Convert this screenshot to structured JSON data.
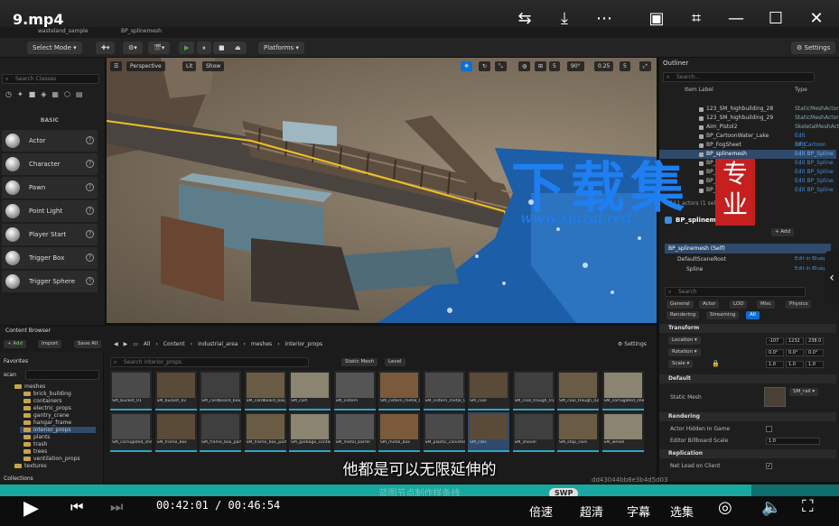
{
  "player": {
    "title": "9.mp4",
    "current_time": "00:42:01",
    "total_time": "00:46:54",
    "progress": 0.8958,
    "speed_label": "倍速",
    "quality_label": "超清",
    "subtitle_label": "字幕",
    "episodes_label": "选集",
    "swp_badge": "SWP",
    "subtitle_text": "他都是可以无限延伸的",
    "chapter_caption": "蓝图节点制作样条线",
    "info_text": "dd43044bb8e3b4d5d03"
  },
  "ue": {
    "tabs": [
      "wasteland_sample",
      "BP_splinemesh"
    ],
    "toolbar": {
      "select_mode": "Select Mode",
      "platforms": "Platforms",
      "settings": "Settings"
    },
    "place_actors": {
      "search_placeholder": "Search Classes",
      "category": "BASIC",
      "items": [
        "Actor",
        "Character",
        "Pawn",
        "Point Light",
        "Player Start",
        "Trigger Box",
        "Trigger Sphere"
      ]
    },
    "viewport": {
      "perspective": "Perspective",
      "lit": "Lit",
      "show": "Show",
      "grid": "5",
      "angle": "90°",
      "scale": "0.25",
      "cam": "5"
    },
    "outliner": {
      "title": "Outliner",
      "search_placeholder": "Search...",
      "col_label": "Item Label",
      "col_type": "Type",
      "rows": [
        {
          "name": "123_SM_highbuilding_28",
          "type": "StaticMeshActor"
        },
        {
          "name": "123_SM_highbuilding_29",
          "type": "StaticMeshActor"
        },
        {
          "name": "Aim_Pistol2",
          "type": "SkeletalMeshActor"
        },
        {
          "name": "BP_CartoonWater_Lake",
          "type": "Edit BP_Cartoon"
        },
        {
          "name": "BP_FogSheet",
          "type": "Edit BP_FogShe"
        },
        {
          "name": "BP_splinemesh",
          "type": "Edit BP_Spline"
        },
        {
          "name": "BP_Splinemesh_1",
          "type": "Edit BP_Spline"
        },
        {
          "name": "BP_Splinemesh_2",
          "type": "Edit BP_Spline"
        },
        {
          "name": "BP_Splinemesh_3",
          "type": "Edit BP_Spline"
        },
        {
          "name": "BP_Splinemesh_4",
          "type": "Edit BP_Spline"
        }
      ],
      "status": "2,111 actors (1 selected)"
    },
    "details": {
      "title": "BP_splinemesh",
      "add_label": "+ Add",
      "self_label": "BP_splinemesh (Self)",
      "components": [
        {
          "name": "DefaultSceneRoot",
          "link": "Edit in Blueprint"
        },
        {
          "name": "Spline",
          "link": "Edit in Blueprint"
        }
      ],
      "search_placeholder": "Search",
      "filter_tabs": [
        "General",
        "Actor",
        "LOD",
        "Misc",
        "Physics",
        "Rendering",
        "Streaming",
        "All"
      ],
      "transform": {
        "section": "Transform",
        "location_label": "Location",
        "rotation_label": "Rotation",
        "scale_label": "Scale",
        "location": [
          "-107",
          "1232",
          "238.0"
        ],
        "rotation": [
          "0.0°",
          "0.0°",
          "0.0°"
        ],
        "scale": [
          "1.0",
          "1.0",
          "1.0"
        ]
      },
      "default_section": "Default",
      "static_mesh_label": "Static Mesh",
      "static_mesh_value": "SM_rail",
      "rendering_section": "Rendering",
      "actor_hidden_label": "Actor Hidden In Game",
      "billboard_label": "Editor Billboard Scale",
      "billboard_value": "1.0",
      "replication_section": "Replication",
      "net_load_label": "Net Load on Client"
    },
    "content_browser": {
      "title": "Content Browser",
      "add": "+ Add",
      "import": "Import",
      "save_all": "Save All",
      "path": [
        "All",
        "Content",
        "industrial_area",
        "meshes",
        "interior_props"
      ],
      "settings": "Settings",
      "search_placeholder": "Search interior_props",
      "filter_static": "Static Mesh",
      "filter_level": "Level",
      "favorites": "Favorites",
      "root": "scan",
      "tree": [
        "meshes",
        "brick_building",
        "containers",
        "electric_props",
        "gantry_crane",
        "hangar_frame",
        "interior_props",
        "plants",
        "trash",
        "trees",
        "ventilation_props",
        "textures"
      ],
      "collections": "Collections",
      "row1": [
        "SM_bucket_01",
        "SM_bucket_02",
        "SM_cardboard_box_01",
        "SM_cardboard_box_03",
        "SM_cart",
        "SM_cistern",
        "SM_cistern_metal_01",
        "SM_cistern_metal_02",
        "SM_coal",
        "SM_coal_trough_01",
        "SM_coal_trough_02",
        "SM_corrugated_sheet_01"
      ],
      "row2": [
        "SM_corrugated_sheet_02",
        "SM_frame_box",
        "SM_frame_box_part_01",
        "SM_frame_box_part_02",
        "SM_garbage_container",
        "SM_metal_barrel",
        "SM_metal_box",
        "SM_plastic_canister",
        "SM_rails",
        "SM_shovel",
        "SM_stop_rails",
        "SM_wheel"
      ]
    }
  },
  "watermark": {
    "main": "下载集",
    "url": "www.xiazai.red",
    "seal": "专业"
  }
}
